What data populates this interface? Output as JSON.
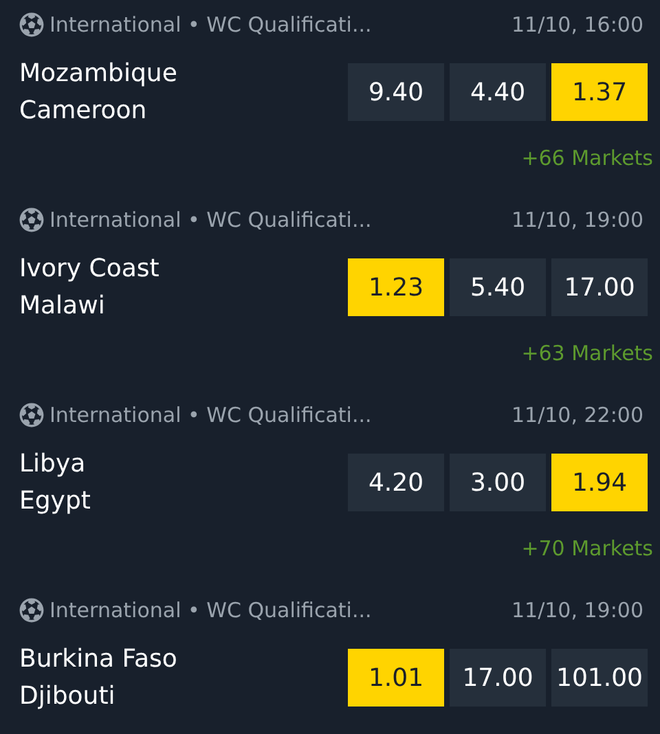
{
  "matches": [
    {
      "league": "International • WC Qualificati...",
      "time": "11/10, 16:00",
      "teams": [
        "Mozambique",
        "Cameroon"
      ],
      "odds": [
        {
          "value": "9.40",
          "selected": false
        },
        {
          "value": "4.40",
          "selected": false
        },
        {
          "value": "1.37",
          "selected": true
        }
      ],
      "markets": "+66 Markets"
    },
    {
      "league": "International • WC Qualificati...",
      "time": "11/10, 19:00",
      "teams": [
        "Ivory Coast",
        "Malawi"
      ],
      "odds": [
        {
          "value": "1.23",
          "selected": true
        },
        {
          "value": "5.40",
          "selected": false
        },
        {
          "value": "17.00",
          "selected": false
        }
      ],
      "markets": "+63 Markets"
    },
    {
      "league": "International • WC Qualificati...",
      "time": "11/10, 22:00",
      "teams": [
        "Libya",
        "Egypt"
      ],
      "odds": [
        {
          "value": "4.20",
          "selected": false
        },
        {
          "value": "3.00",
          "selected": false
        },
        {
          "value": "1.94",
          "selected": true
        }
      ],
      "markets": "+70 Markets"
    },
    {
      "league": "International • WC Qualificati...",
      "time": "11/10, 19:00",
      "teams": [
        "Burkina Faso",
        "Djibouti"
      ],
      "odds": [
        {
          "value": "1.01",
          "selected": true
        },
        {
          "value": "17.00",
          "selected": false
        },
        {
          "value": "101.00",
          "selected": false
        }
      ]
    }
  ]
}
